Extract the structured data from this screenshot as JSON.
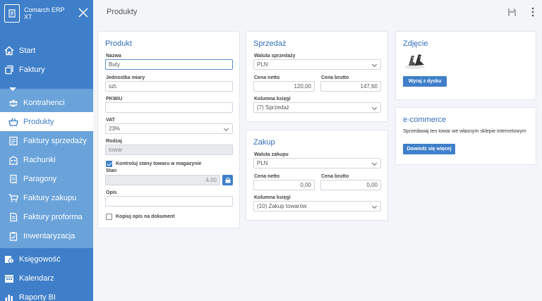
{
  "app": {
    "name": "Comarch ERP XT"
  },
  "header": {
    "title": "Produkty"
  },
  "sidebar": {
    "top_items": [
      {
        "label": "Start"
      },
      {
        "label": "Faktury"
      }
    ],
    "sub_items": [
      {
        "label": "Kontrahenci"
      },
      {
        "label": "Produkty"
      },
      {
        "label": "Faktury sprzedaży"
      },
      {
        "label": "Rachunki"
      },
      {
        "label": "Paragony"
      },
      {
        "label": "Faktury zakupu"
      },
      {
        "label": "Faktury proforma"
      },
      {
        "label": "Inwentaryzacja"
      }
    ],
    "bottom_items": [
      {
        "label": "Księgowość"
      },
      {
        "label": "Kalendarz"
      },
      {
        "label": "Raporty BI"
      }
    ]
  },
  "produkt": {
    "title": "Produkt",
    "nazwa_label": "Nazwa",
    "nazwa_value": "Buty",
    "jm_label": "Jednostka miary",
    "jm_value": "szt.",
    "pkwiu_label": "PKWiU",
    "pkwiu_value": "",
    "vat_label": "VAT",
    "vat_value": "23%",
    "rodzaj_label": "Rodzaj",
    "rodzaj_value": "towar",
    "kontroluj_label": "Kontroluj stany towaru w magazynie",
    "stan_label": "Stan",
    "stan_value": "4,00",
    "opis_label": "Opis",
    "opis_value": "",
    "kopiuj_label": "Kopiuj opis na dokument"
  },
  "sprzedaz": {
    "title": "Sprzedaż",
    "waluta_label": "Waluta sprzedaży",
    "waluta_value": "PLN",
    "netto_label": "Cena netto",
    "netto_value": "120,00",
    "brutto_label": "Cena brutto",
    "brutto_value": "147,60",
    "kolumna_label": "Kolumna księgi",
    "kolumna_value": "(7) Sprzedaż"
  },
  "zakup": {
    "title": "Zakup",
    "waluta_label": "Waluta zakupu",
    "waluta_value": "PLN",
    "netto_label": "Cena netto",
    "netto_value": "0,00",
    "brutto_label": "Cena brutto",
    "brutto_value": "0,00",
    "kolumna_label": "Kolumna księgi",
    "kolumna_value": "(10) Zakup towarów"
  },
  "zdjecie": {
    "title": "Zdjęcie",
    "button": "Wyraj z dysku"
  },
  "ecommerce": {
    "title": "e-commerce",
    "text": "Sprzedawaj ten towar we własnym sklepie internetowym",
    "button": "Dowiedz się więcej"
  },
  "colors": {
    "sidebar": "#3f7fc9",
    "submenu": "#6aa3da",
    "accent": "#2f6fb8"
  }
}
